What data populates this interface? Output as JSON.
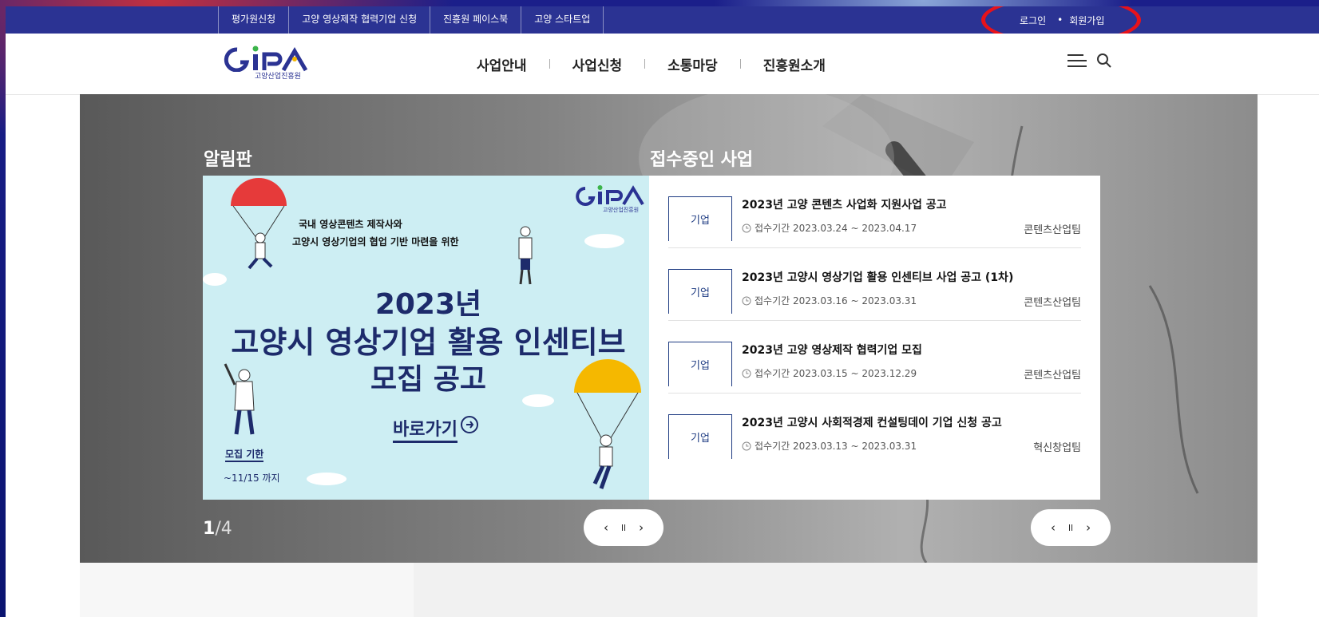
{
  "topbar": {
    "links": [
      "평가원신청",
      "고양 영상제작 협력기업 신청",
      "진흥원 페이스북",
      "고양 스타트업"
    ],
    "login": "로그인",
    "signup": "회원가입"
  },
  "header": {
    "logo_text": "GIPA",
    "logo_sub": "고양산업진흥원",
    "nav": [
      "사업안내",
      "사업신청",
      "소통마당",
      "진흥원소개"
    ],
    "icons": [
      "menu-icon",
      "search-icon"
    ]
  },
  "notice": {
    "title": "알림판",
    "banner": {
      "logo_sub": "고양산업진흥원",
      "sub1": "국내 영상콘텐츠 제작사와",
      "sub2": "고양시 영상기업의 협업 기반 마련을 위한",
      "year": "2023년",
      "title1": "고양시 영상기업 활용 인센티브",
      "title2": "모집 공고",
      "go": "바로가기",
      "deadline_label": "모집 기한",
      "deadline": "~11/15 까지"
    },
    "pager_current": "1",
    "pager_total": "/4"
  },
  "receipt": {
    "title": "접수중인 사업",
    "items": [
      {
        "tag": "기업",
        "title": "2023년 고양 콘텐츠 사업화 지원사업 공고",
        "period": "접수기간 2023.03.24 ~ 2023.04.17",
        "team": "콘텐츠산업팀"
      },
      {
        "tag": "기업",
        "title": "2023년 고양시 영상기업 활용 인센티브 사업 공고 (1차)",
        "period": "접수기간 2023.03.16 ~ 2023.03.31",
        "team": "콘텐츠산업팀"
      },
      {
        "tag": "기업",
        "title": "2023년 고양 영상제작 협력기업 모집",
        "period": "접수기간 2023.03.15 ~ 2023.12.29",
        "team": "콘텐츠산업팀"
      },
      {
        "tag": "기업",
        "title": "2023년 고양시 사회적경제 컨설팅데이 기업 신청 공고",
        "period": "접수기간 2023.03.13 ~ 2023.03.31",
        "team": "혁신창업팀"
      }
    ]
  },
  "controls": {
    "prev": "‹",
    "pause": "ll",
    "next": "›"
  },
  "colors": {
    "topbar": "#2b3393",
    "brand": "#1d2b6b",
    "highlight": "#e8121a",
    "tag_border": "#1e3b82"
  }
}
